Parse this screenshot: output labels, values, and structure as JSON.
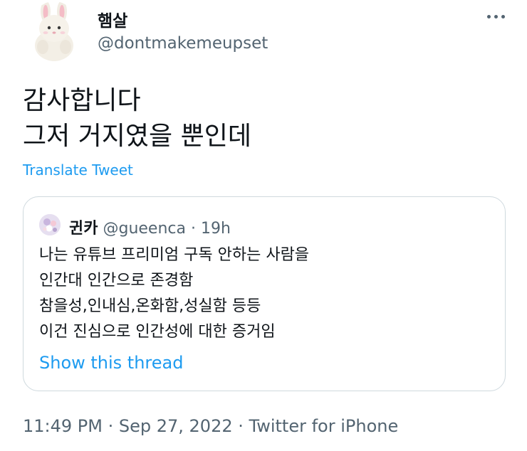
{
  "author": {
    "display_name": "햄살",
    "handle": "@dontmakemeupset",
    "avatar_icon": "bunny-plush-avatar"
  },
  "more_icon": "more-dots-icon",
  "tweet": {
    "lines": [
      "감사합니다",
      "그저 거지였을 뿐인데"
    ]
  },
  "translate_label": "Translate Tweet",
  "quoted": {
    "display_name": "귄카",
    "handle": "@gueenca",
    "separator": " · ",
    "time": "19h",
    "avatar_icon": "floral-avatar",
    "lines": [
      "나는 유튜브 프리미엄 구독 안하는 사람을",
      "인간대 인간으로 존경함",
      "참을성,인내심,온화함,성실함 등등",
      "이건 진심으로 인간성에 대한 증거임"
    ],
    "show_thread_label": "Show this thread"
  },
  "footer": {
    "time": "11:49 PM",
    "sep1": " · ",
    "date": "Sep 27, 2022",
    "sep2": " · ",
    "source": "Twitter for iPhone"
  },
  "colors": {
    "link": "#1d9bf0",
    "secondary_text": "#536471",
    "primary_text": "#0f1419",
    "border": "#cfd9de"
  }
}
